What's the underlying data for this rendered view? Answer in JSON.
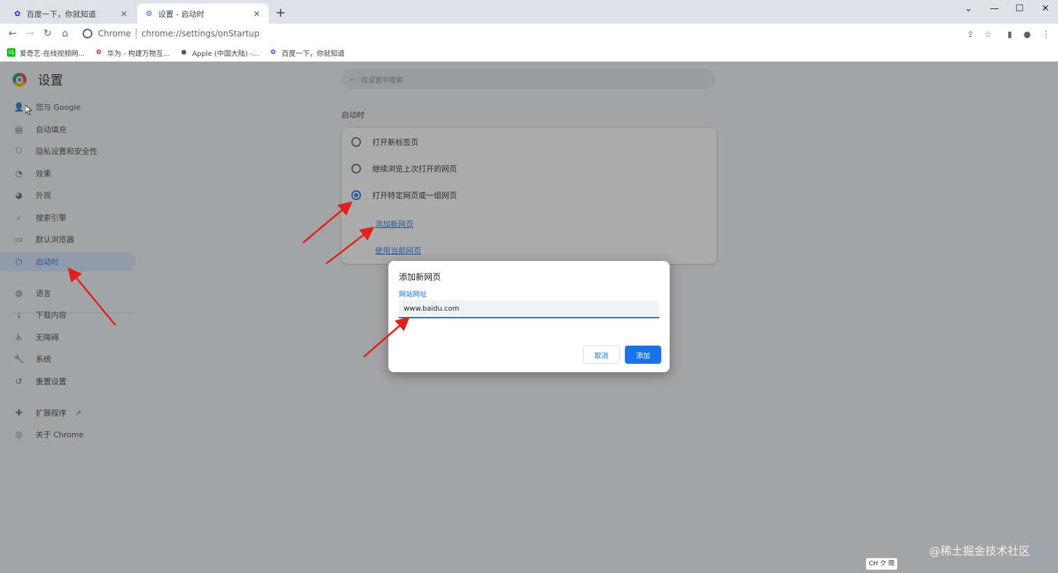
{
  "browser": {
    "tabs": [
      {
        "title": "百度一下，你就知道",
        "icon": "baidu-paw-icon",
        "active": false
      },
      {
        "title": "设置 - 启动时",
        "icon": "gear-icon",
        "active": true
      }
    ],
    "new_tab": "+",
    "window_controls": {
      "dropdown": "⌄",
      "minimize": "—",
      "maximize": "☐",
      "close": "✕"
    },
    "omnibox": {
      "site": "Chrome",
      "url": "chrome://settings/onStartup"
    },
    "bookmarks": [
      {
        "label": "爱奇艺-在线视频网...",
        "icon": "iqiyi-icon"
      },
      {
        "label": "华为 - 构建万物互...",
        "icon": "huawei-icon"
      },
      {
        "label": "Apple (中国大陆) -...",
        "icon": "apple-icon"
      },
      {
        "label": "百度一下，你就知道",
        "icon": "baidu-paw-icon"
      }
    ]
  },
  "settings": {
    "title": "设置",
    "search_placeholder": "在设置中搜索",
    "nav": [
      {
        "label": "您与 Google",
        "icon": "person-icon"
      },
      {
        "label": "自动填充",
        "icon": "clipboard-icon"
      },
      {
        "label": "隐私设置和安全性",
        "icon": "shield-icon"
      },
      {
        "label": "效果",
        "icon": "speedometer-icon"
      },
      {
        "label": "外观",
        "icon": "palette-icon"
      },
      {
        "label": "搜索引擎",
        "icon": "search-icon"
      },
      {
        "label": "默认浏览器",
        "icon": "browser-icon"
      },
      {
        "label": "启动时",
        "icon": "power-icon",
        "active": true
      },
      {
        "label": "语言",
        "icon": "globe-icon"
      },
      {
        "label": "下载内容",
        "icon": "download-icon"
      },
      {
        "label": "无障碍",
        "icon": "accessibility-icon"
      },
      {
        "label": "系统",
        "icon": "wrench-icon"
      },
      {
        "label": "重置设置",
        "icon": "history-icon"
      },
      {
        "label": "扩展程序",
        "icon": "puzzle-icon"
      },
      {
        "label": "关于 Chrome",
        "icon": "chrome-icon"
      }
    ],
    "section_title": "启动时",
    "options": [
      {
        "label": "打开新标签页",
        "checked": false
      },
      {
        "label": "继续浏览上次打开的网页",
        "checked": false
      },
      {
        "label": "打开特定网页或一组网页",
        "checked": true
      }
    ],
    "add_page_link": "添加新网页",
    "use_current_link": "使用当前网页"
  },
  "dialog": {
    "title": "添加新网页",
    "field_label": "网站网址",
    "field_value": "www.baidu.com",
    "cancel": "取消",
    "add": "添加"
  },
  "ime": "CH ク 简",
  "watermark": "@稀土掘金技术社区",
  "watermark_logo": "极光下载站",
  "colors": {
    "accent": "#1a73e8",
    "annotation_arrow": "#e0201c"
  }
}
